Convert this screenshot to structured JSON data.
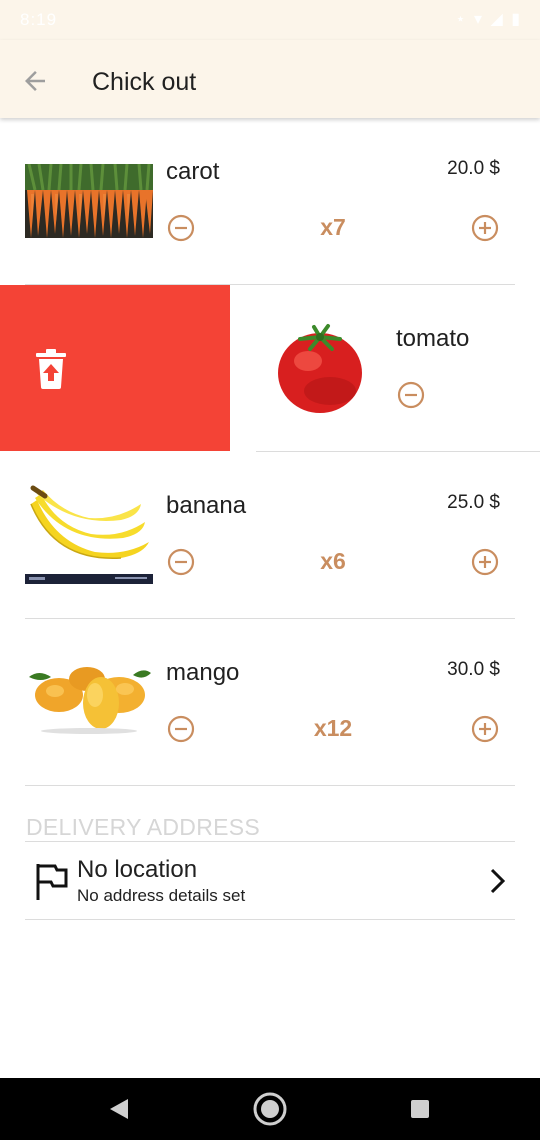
{
  "status_bar": {
    "time": "8:19",
    "icons": "⋆ ▾ ◢ ▮"
  },
  "app_bar": {
    "title": "Chick out"
  },
  "items": [
    {
      "name": "carot",
      "price": "20.0 $",
      "quantity": "x7",
      "image": "carrots"
    },
    {
      "name": "tomato",
      "image": "tomato",
      "swiped": true
    },
    {
      "name": "banana",
      "price": "25.0 $",
      "quantity": "x6",
      "image": "bananas"
    },
    {
      "name": "mango",
      "price": "30.0 $",
      "quantity": "x12",
      "image": "mangoes"
    }
  ],
  "delivery": {
    "section_title": "DELIVERY ADDRESS",
    "title": "No location",
    "subtitle": "No address details set"
  },
  "colors": {
    "accent": "#c98d5f",
    "delete": "#f44336",
    "app_bar": "#fcf5ea"
  },
  "icons": [
    "back-arrow-icon",
    "minus-circle-icon",
    "plus-circle-icon",
    "delete-icon",
    "flag-icon",
    "chevron-right-icon"
  ]
}
